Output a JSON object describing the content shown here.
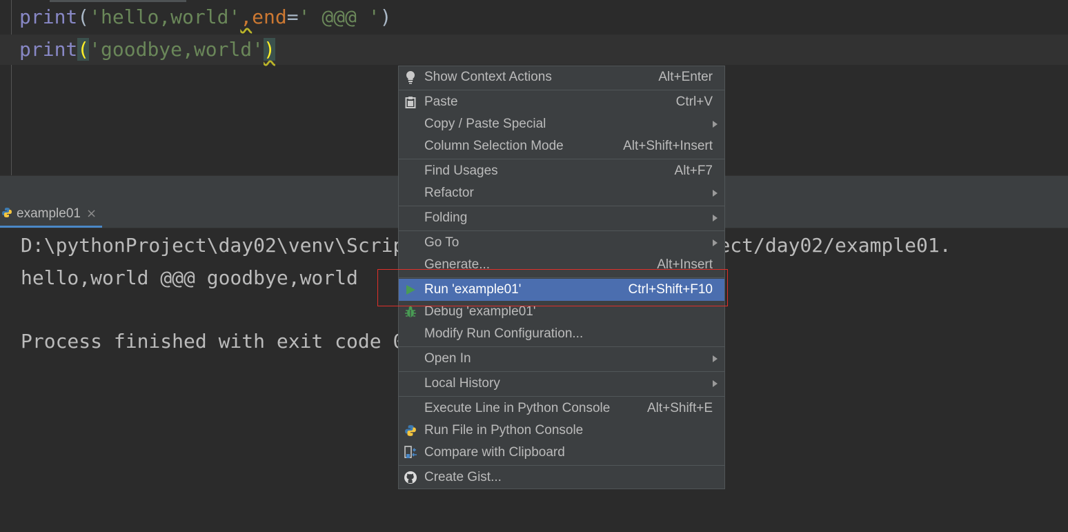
{
  "editor": {
    "line1": {
      "kw": "print",
      "open": "(",
      "str1": "'hello,world'",
      "comma": ",",
      "param": "end",
      "eq": "=",
      "str2": "' @@@ '",
      "close": ")"
    },
    "line2": {
      "kw": "print",
      "open": "(",
      "str1": "'goodbye,world'",
      "close": ")"
    }
  },
  "run_panel": {
    "tab_label": "example01",
    "tab_close": "×",
    "console_lines": [
      "D:\\pythonProject\\day02\\venv\\Scripts\\python.exe D:/pythonProject/day02/example01.",
      "hello,world @@@ goodbye,world",
      "Process finished with exit code 0"
    ]
  },
  "context_menu": {
    "items": [
      {
        "label": "Show Context Actions",
        "shortcut": "Alt+Enter",
        "icon": "lightbulb-icon"
      },
      {
        "label": "Paste",
        "shortcut": "Ctrl+V",
        "icon": "clipboard-icon"
      },
      {
        "label": "Copy / Paste Special",
        "submenu": true
      },
      {
        "label": "Column Selection Mode",
        "shortcut": "Alt+Shift+Insert"
      },
      {
        "label": "Find Usages",
        "shortcut": "Alt+F7"
      },
      {
        "label": "Refactor",
        "submenu": true
      },
      {
        "label": "Folding",
        "submenu": true
      },
      {
        "label": "Go To",
        "submenu": true
      },
      {
        "label": "Generate...",
        "shortcut": "Alt+Insert"
      },
      {
        "label": "Run 'example01'",
        "shortcut": "Ctrl+Shift+F10",
        "icon": "run-icon",
        "selected": true
      },
      {
        "label": "Debug 'example01'",
        "icon": "debug-bug-icon"
      },
      {
        "label": "Modify Run Configuration..."
      },
      {
        "label": "Open In",
        "submenu": true
      },
      {
        "label": "Local History",
        "submenu": true
      },
      {
        "label": "Execute Line in Python Console",
        "shortcut": "Alt+Shift+E"
      },
      {
        "label": "Run File in Python Console",
        "icon": "python-icon"
      },
      {
        "label": "Compare with Clipboard",
        "icon": "compare-icon"
      },
      {
        "label": "Create Gist...",
        "icon": "github-icon"
      }
    ]
  },
  "colors": {
    "selection": "#4b6eaf",
    "highlight_box": "#e0302a",
    "run_green": "#499c54"
  }
}
